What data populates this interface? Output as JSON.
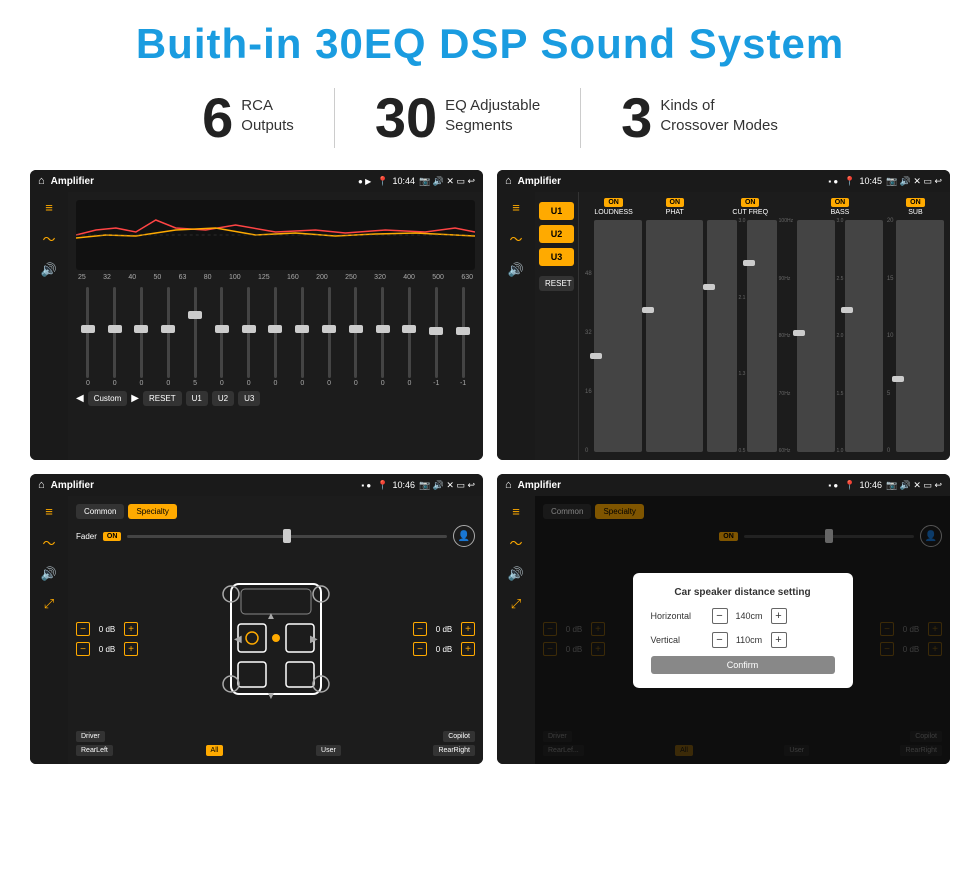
{
  "title": "Buith-in 30EQ DSP Sound System",
  "stats": [
    {
      "number": "6",
      "label_line1": "RCA",
      "label_line2": "Outputs"
    },
    {
      "number": "30",
      "label_line1": "EQ Adjustable",
      "label_line2": "Segments"
    },
    {
      "number": "3",
      "label_line1": "Kinds of",
      "label_line2": "Crossover Modes"
    }
  ],
  "screens": [
    {
      "id": "eq-screen",
      "status_time": "10:44",
      "app_name": "Amplifier",
      "type": "eq"
    },
    {
      "id": "dsp-screen",
      "status_time": "10:45",
      "app_name": "Amplifier",
      "type": "dsp"
    },
    {
      "id": "fader-screen",
      "status_time": "10:46",
      "app_name": "Amplifier",
      "type": "fader"
    },
    {
      "id": "distance-screen",
      "status_time": "10:46",
      "app_name": "Amplifier",
      "type": "distance"
    }
  ],
  "eq_labels": [
    "25",
    "32",
    "40",
    "50",
    "63",
    "80",
    "100",
    "125",
    "160",
    "200",
    "250",
    "320",
    "400",
    "500",
    "630"
  ],
  "eq_values": [
    "0",
    "0",
    "0",
    "0",
    "5",
    "0",
    "0",
    "0",
    "0",
    "0",
    "0",
    "0",
    "0",
    "-1",
    "0",
    "-1"
  ],
  "eq_preset": "Custom",
  "buttons": {
    "reset": "RESET",
    "u1": "U1",
    "u2": "U2",
    "u3": "U3",
    "confirm": "Confirm",
    "common": "Common",
    "specialty": "Specialty",
    "driver": "Driver",
    "copilot": "Copilot",
    "rear_left": "RearLeft",
    "all": "All",
    "user": "User",
    "rear_right": "RearRight"
  },
  "dsp_controls": [
    {
      "name": "LOUDNESS",
      "on": true
    },
    {
      "name": "PHAT",
      "on": true
    },
    {
      "name": "CUT FREQ",
      "on": true
    },
    {
      "name": "BASS",
      "on": true
    },
    {
      "name": "SUB",
      "on": true
    }
  ],
  "fader_label": "Fader",
  "fader_on": "ON",
  "vol_values": [
    "0 dB",
    "0 dB",
    "0 dB",
    "0 dB"
  ],
  "dialog": {
    "title": "Car speaker distance setting",
    "horizontal_label": "Horizontal",
    "horizontal_value": "140cm",
    "vertical_label": "Vertical",
    "vertical_value": "110cm",
    "confirm": "Confirm"
  }
}
